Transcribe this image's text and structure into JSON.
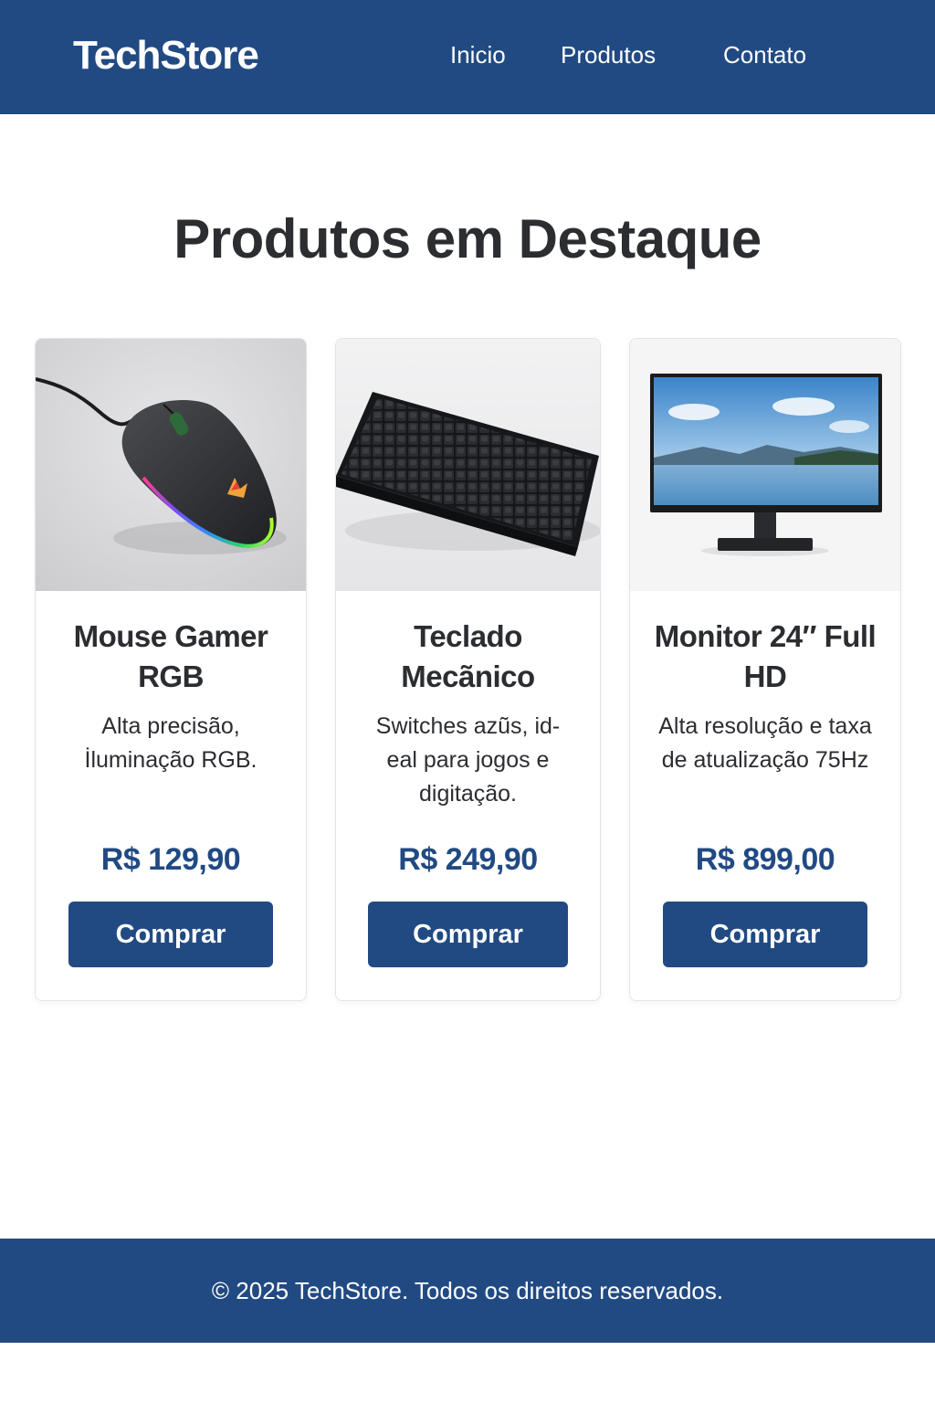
{
  "header": {
    "brand": "TechStore",
    "nav": [
      {
        "label": "Inicio"
      },
      {
        "label": "Produtos"
      },
      {
        "label": "Contato"
      }
    ]
  },
  "main": {
    "title": "Produtos em Destaque",
    "products": [
      {
        "name": "Mouse Gamer RGB",
        "description": "Alta precisão, İluminação RGB.",
        "price": "R$ 129,90",
        "button_label": "Comprar",
        "image": "gaming-mouse-photo"
      },
      {
        "name": "Teclado Mecãnico",
        "description": "Switches azũs, id-eal para jogos e digitação.",
        "price": "R$ 249,90",
        "button_label": "Comprar",
        "image": "mechanical-keyboard-photo"
      },
      {
        "name": "Monitor 24″ Full HD",
        "description": "Alta resolução e taxa de atualização 75Hz",
        "price": "R$ 899,00",
        "button_label": "Comprar",
        "image": "monitor-photo"
      }
    ]
  },
  "footer": {
    "text": "© 2025 TechStore. Todos os direitos reservados."
  },
  "colors": {
    "brand_blue": "#214a83",
    "page_background": "#ffffff",
    "text_dark": "#2b2d31",
    "card_border": "#e4e4e6"
  }
}
